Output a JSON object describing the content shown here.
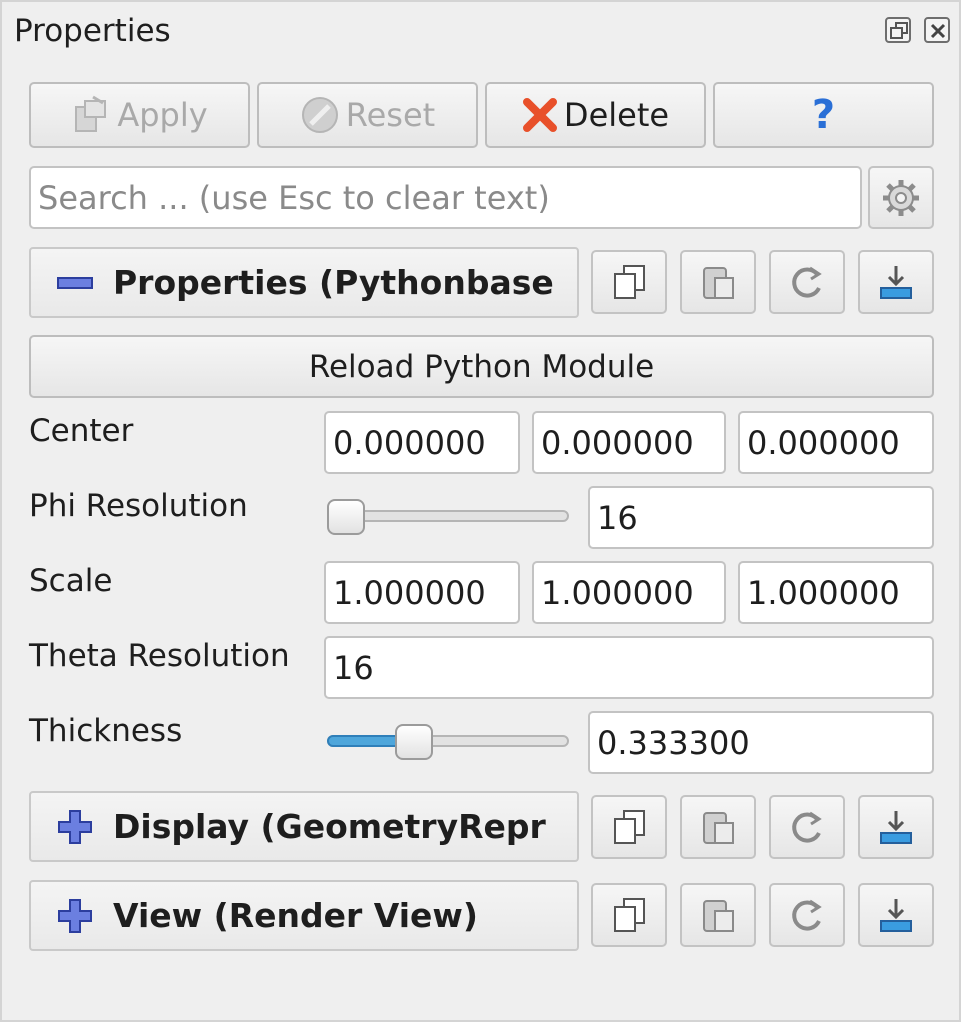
{
  "window": {
    "title": "Properties"
  },
  "toolbar": {
    "apply_label": "Apply",
    "reset_label": "Reset",
    "delete_label": "Delete",
    "help_label": "?"
  },
  "search": {
    "placeholder": "Search ... (use Esc to clear text)",
    "value": ""
  },
  "sections": {
    "properties": {
      "title": "Properties (Pythonbase",
      "expanded": true
    },
    "display": {
      "title": "Display (GeometryRepr",
      "expanded": false
    },
    "view": {
      "title": "View (Render View)",
      "expanded": false
    }
  },
  "reload_button": "Reload Python Module",
  "fields": {
    "center": {
      "label": "Center",
      "values": [
        "0.000000",
        "0.000000",
        "0.000000"
      ]
    },
    "phi_resolution": {
      "label": "Phi Resolution",
      "value": "16",
      "slider_fraction": 0.0
    },
    "scale": {
      "label": "Scale",
      "values": [
        "1.000000",
        "1.000000",
        "1.000000"
      ]
    },
    "theta_resolution": {
      "label": "Theta Resolution",
      "value": "16"
    },
    "thickness": {
      "label": "Thickness",
      "value": "0.333300",
      "slider_fraction": 0.3333
    }
  },
  "colors": {
    "accent": "#4ea6db",
    "delete_red": "#e8502a",
    "help_blue": "#2a6fd6",
    "section_icon": "#3b52c9"
  },
  "icons": {
    "apply": "apply-icon",
    "reset": "reset-icon",
    "delete": "delete-x-icon",
    "help": "question-mark-icon",
    "settings": "gear-icon",
    "copy": "copy-icon",
    "paste": "paste-icon",
    "restore_default": "restore-icon",
    "save_default": "save-icon"
  }
}
